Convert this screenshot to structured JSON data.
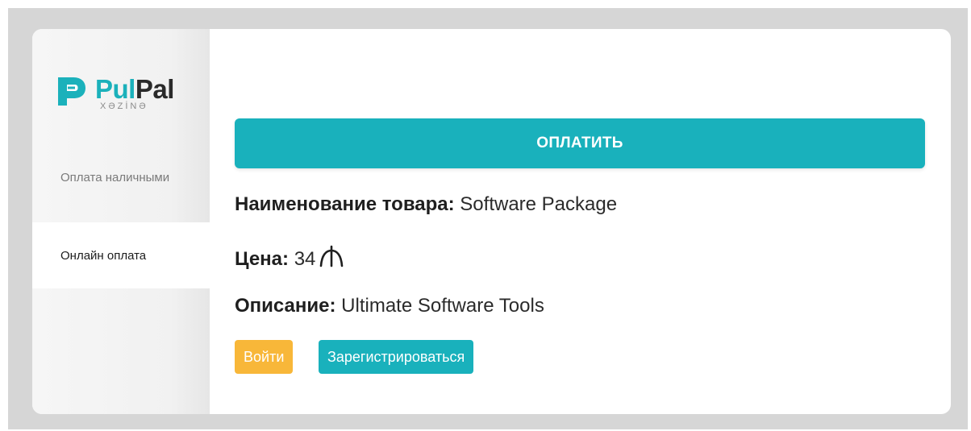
{
  "brand": {
    "name_part1": "Pul",
    "name_part2": "Pal",
    "subtitle": "XƏZİNƏ",
    "accent_color": "#1bb1bb",
    "dark_color": "#2a2a2a"
  },
  "sidebar": {
    "items": [
      {
        "label": "Оплата наличными",
        "active": false
      },
      {
        "label": "Онлайн оплата",
        "active": true
      }
    ]
  },
  "main": {
    "pay_button_label": "ОПЛАТИТЬ",
    "product": {
      "name_label": "Наименование товара:",
      "name_value": "Software Package",
      "price_label": "Цена:",
      "price_value": "34",
      "currency_icon": "manat-icon",
      "description_label": "Описание:",
      "description_value": "Ultimate Software Tools"
    },
    "login_label": "Войти",
    "register_label": "Зарегистрироваться"
  },
  "colors": {
    "primary": "#19b1bc",
    "warning": "#f8b739",
    "backdrop": "#d6d6d6",
    "sidebar": "#f1f1f1"
  }
}
